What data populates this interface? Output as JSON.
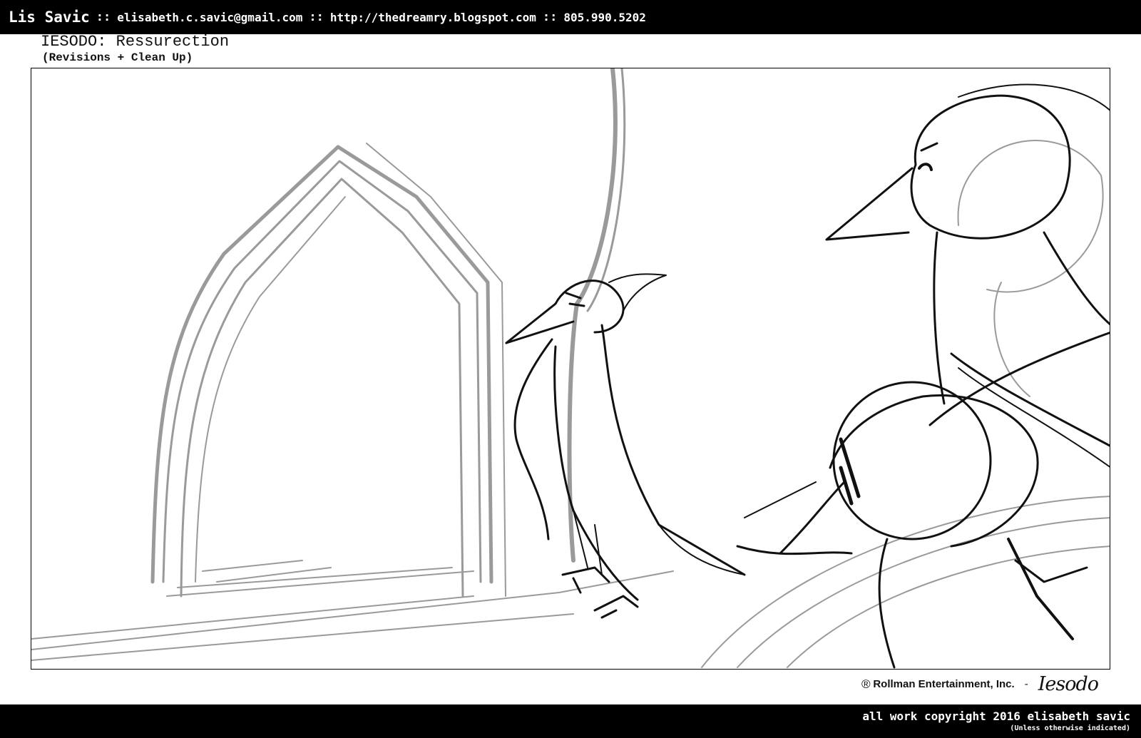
{
  "header": {
    "name": "Lis Savic",
    "separator": "::",
    "email": "elisabeth.c.savic@gmail.com",
    "website": "http://thedreamry.blogspot.com",
    "phone": "805.990.5202"
  },
  "project": {
    "title": "IESODO: Ressurection",
    "subtitle": "(Revisions + Clean Up)"
  },
  "credit": {
    "mark": "®",
    "company": "Rollman Entertainment, Inc.",
    "dash": "-",
    "logo": "Iesodo"
  },
  "footer": {
    "copyright": "all work copyright 2016 elisabeth savic",
    "note": "(Unless otherwise indicated)"
  },
  "colors": {
    "bar_background": "#000000",
    "bar_text": "#ffffff",
    "sketch_gray": "#9a9a9a",
    "sketch_black": "#111111"
  }
}
